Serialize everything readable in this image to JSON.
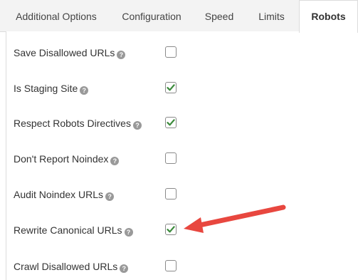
{
  "tabs": [
    {
      "label": "Additional Options",
      "active": false
    },
    {
      "label": "Configuration",
      "active": false
    },
    {
      "label": "Speed",
      "active": false
    },
    {
      "label": "Limits",
      "active": false
    },
    {
      "label": "Robots",
      "active": true
    }
  ],
  "options": [
    {
      "label": "Save Disallowed URLs",
      "help": "?",
      "checked": false
    },
    {
      "label": "Is Staging Site",
      "help": "?",
      "checked": true
    },
    {
      "label": "Respect Robots Directives",
      "help": "?",
      "checked": true
    },
    {
      "label": "Don't Report Noindex",
      "help": "?",
      "checked": false
    },
    {
      "label": "Audit Noindex URLs",
      "help": "?",
      "checked": false
    },
    {
      "label": "Rewrite Canonical URLs",
      "help": "?",
      "checked": true
    },
    {
      "label": "Crawl Disallowed URLs",
      "help": "?",
      "checked": false
    }
  ],
  "colors": {
    "check": "#3c8b3c",
    "arrow": "#e8473f"
  },
  "annotation": {
    "icon": "red-arrow-icon",
    "points_to_option": "Rewrite Canonical URLs"
  }
}
